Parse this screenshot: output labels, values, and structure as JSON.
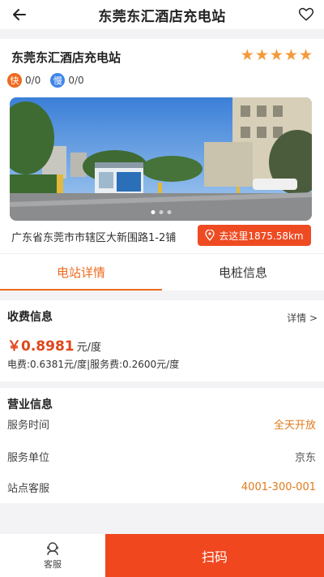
{
  "header": {
    "title": "东莞东汇酒店充电站"
  },
  "station": {
    "name": "东莞东汇酒店充电站",
    "rating": 5,
    "fast": {
      "label": "快",
      "value": "0/0"
    },
    "slow": {
      "label": "慢",
      "value": "0/0"
    },
    "photo_count": 3,
    "photo_index": 1,
    "address": "广东省东莞市市辖区大新围路1-2铺",
    "nav_button": "去这里1875.58km"
  },
  "tabs": [
    {
      "label": "电站详情",
      "active": true
    },
    {
      "label": "电桩信息",
      "active": false
    }
  ],
  "fee": {
    "title": "收费信息",
    "more": "详情 >",
    "price": "￥0.8981",
    "unit": "元/度",
    "detail": "电费:0.6381元/度|服务费:0.2600元/度"
  },
  "business": {
    "title": "营业信息",
    "rows": [
      {
        "key": "服务时间",
        "value": "全天开放"
      },
      {
        "key": "服务单位",
        "value": "京东"
      },
      {
        "key": "站点客服",
        "value": "4001-300-001"
      }
    ]
  },
  "bottom": {
    "service_label": "客服",
    "scan_label": "扫码"
  },
  "colors": {
    "accent": "#ee6a1f",
    "button": "#f0471f",
    "fast_badge": "#ee6a1f",
    "slow_badge": "#3f86e8",
    "star": "#f39a3a"
  }
}
